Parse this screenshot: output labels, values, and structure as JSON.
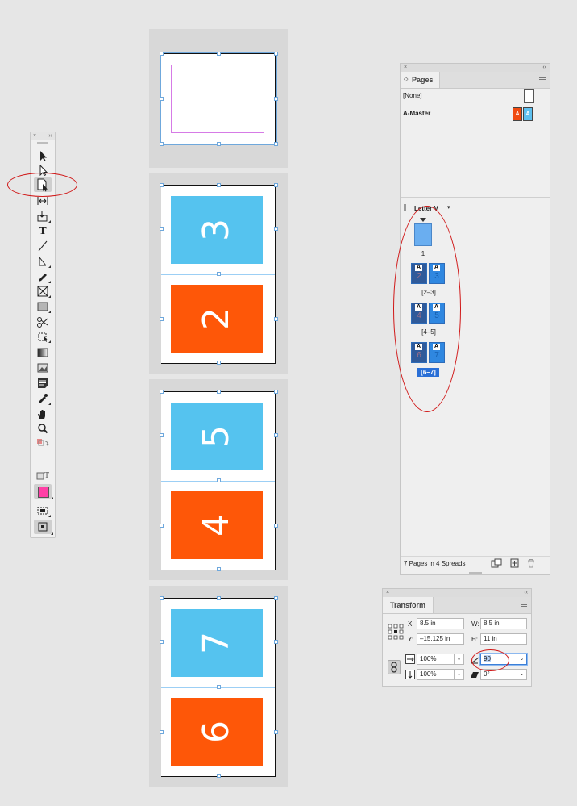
{
  "tools_panel": {
    "close_glyph": "×",
    "collapse_glyph": "››",
    "type_tool_glyph": "T",
    "format_text_glyph": "T",
    "tools": [
      "selection-tool",
      "direct-selection-tool",
      "page-tool",
      "gap-tool",
      "content-collector-tool",
      "type-tool",
      "line-tool",
      "pen-tool",
      "pencil-tool",
      "rectangle-frame-tool",
      "rectangle-tool",
      "scissors-tool",
      "free-transform-tool",
      "gradient-swatch-tool",
      "gradient-feather-tool",
      "note-tool",
      "eyedropper-tool",
      "hand-tool",
      "zoom-tool"
    ],
    "fill_color": "#ff3fa6",
    "accent": "#d01818"
  },
  "canvas": {
    "colors": {
      "blue": "#55c3ef",
      "orange": "#fe5708"
    },
    "spreads": [
      {
        "pages": []
      },
      {
        "pages": [
          "3",
          "2"
        ]
      },
      {
        "pages": [
          "5",
          "4"
        ]
      },
      {
        "pages": [
          "7",
          "6"
        ]
      }
    ]
  },
  "pages_panel": {
    "close_glyph": "×",
    "collapse_glyph": "‹‹",
    "title": "Pages",
    "masters": [
      {
        "label": "[None]"
      },
      {
        "label": "A-Master",
        "prefix_left": "A",
        "prefix_right": "A"
      }
    ],
    "page_size": "Letter V",
    "page_1_label": "1",
    "spreads": [
      {
        "label": "[2–3]",
        "left": "2",
        "right": "3",
        "master": "A"
      },
      {
        "label": "[4–5]",
        "left": "4",
        "right": "5",
        "master": "A"
      },
      {
        "label": "[6–7]",
        "left": "6",
        "right": "7",
        "master": "A",
        "selected": true
      }
    ],
    "status": "7 Pages in 4 Spreads"
  },
  "transform_panel": {
    "close_glyph": "×",
    "collapse_glyph": "‹‹",
    "title": "Transform",
    "x_label": "X:",
    "x_value": "8.5 in",
    "y_label": "Y:",
    "y_value": "–15.125 in",
    "w_label": "W:",
    "w_value": "8.5 in",
    "h_label": "H:",
    "h_value": "11 in",
    "scale_x": "100%",
    "scale_y": "100%",
    "rotation": "90",
    "shear": "0°"
  }
}
